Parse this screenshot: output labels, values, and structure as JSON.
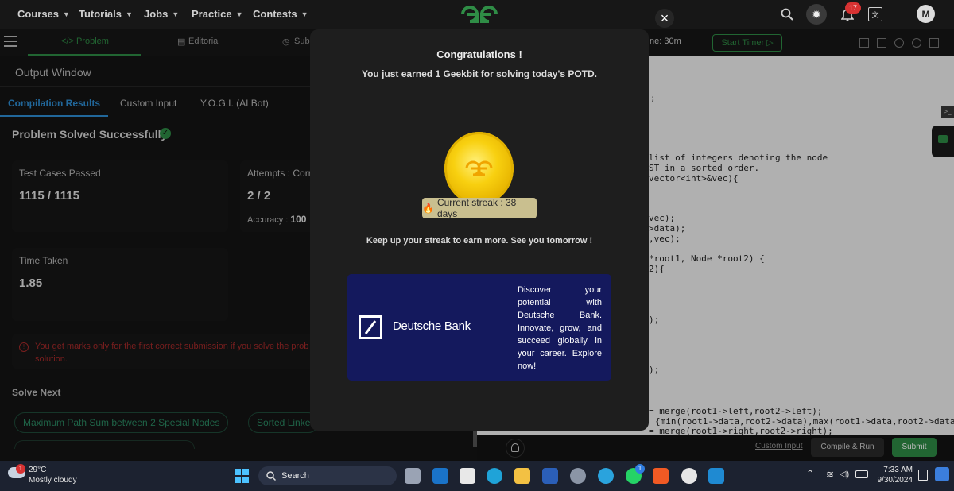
{
  "nav": {
    "items": [
      "Courses",
      "Tutorials",
      "Jobs",
      "Practice",
      "Contests"
    ],
    "notif_count": "17",
    "avatar": "M",
    "logo": "gfg-logo"
  },
  "toolbar": {
    "tabs": [
      {
        "label": "</> Problem"
      },
      {
        "label": "Editorial"
      },
      {
        "label": "Subm"
      }
    ],
    "time_label": "ne: 30m",
    "start_timer": "Start Timer"
  },
  "output": {
    "title": "Output Window",
    "tabs": [
      "Compilation Results",
      "Custom Input",
      "Y.O.G.I. (AI Bot)"
    ],
    "status": "Problem Solved Successfully",
    "test_cases_label": "Test Cases Passed",
    "test_cases_value": "1115 / 1115",
    "attempts_label": "Attempts : Corr",
    "attempts_value": "2 / 2",
    "accuracy_label": "Accuracy :",
    "accuracy_value": "100",
    "time_label": "Time Taken",
    "time_value": "1.85",
    "warning": "You get marks only for the first correct submission if you solve the prob",
    "warning_cont": "solution.",
    "solve_next_title": "Solve Next",
    "solve_next": [
      "Maximum Path Sum between 2 Special Nodes",
      "Sorted Linke"
    ]
  },
  "editor": {
    "lines": [
      {
        "text": ";"
      },
      {
        "text": "list of integers denoting the node"
      },
      {
        "text": "ST in a sorted order."
      },
      {
        "text": "vector<int>&vec){"
      },
      {
        "text": "vec);"
      },
      {
        "text": ">data);"
      },
      {
        "text": ",vec);"
      },
      {
        "text": "*root1, Node *root2) {"
      },
      {
        "text": "2){"
      },
      {
        "text": ");"
      },
      {
        "text": ");"
      },
      {
        "text": "= merge(root1->left,root2->left);"
      },
      {
        "text": "{min(root1->data,root2->data),max(root1->data,root2->data)};"
      },
      {
        "text": "= merge(root1->right,root2->right);"
      }
    ]
  },
  "actions": {
    "custom_input": "Custom Input",
    "compile_run": "Compile & Run",
    "submit": "Submit"
  },
  "modal": {
    "title": "Congratulations !",
    "subtitle": "You just earned 1 Geekbit for solving today's POTD.",
    "streak": "Current streak : 38 days",
    "message": "Keep up your streak to earn more. See you tomorrow !",
    "ad_brand": "Deutsche Bank",
    "ad_text": "Discover your potential with Deutsche Bank. Innovate, grow, and succeed globally in your career. Explore now!"
  },
  "taskbar": {
    "weather_temp": "29°C",
    "weather_desc": "Mostly cloudy",
    "weather_badge": "1",
    "search": "Search",
    "time": "7:33 AM",
    "date": "9/30/2024",
    "whatsapp_badge": "1"
  },
  "colors": {
    "accent_green": "#2f8d46",
    "ad_bg": "#14195d",
    "coin": "#f8d010"
  }
}
